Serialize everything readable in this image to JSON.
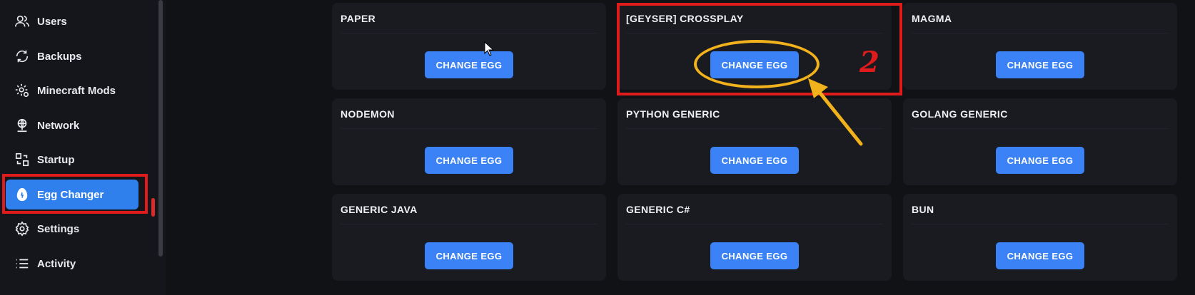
{
  "sidebar": {
    "items": [
      {
        "label": "Users",
        "icon": "users-icon"
      },
      {
        "label": "Backups",
        "icon": "backup-icon"
      },
      {
        "label": "Minecraft Mods",
        "icon": "mods-gear-icon"
      },
      {
        "label": "Network",
        "icon": "network-globe-icon"
      },
      {
        "label": "Startup",
        "icon": "startup-icon"
      },
      {
        "label": "Egg Changer",
        "icon": "egg-icon",
        "active": true
      },
      {
        "label": "Settings",
        "icon": "gear-icon"
      },
      {
        "label": "Activity",
        "icon": "activity-list-icon"
      }
    ]
  },
  "eggs": {
    "button_label": "CHANGE EGG",
    "cards": [
      {
        "title": "PAPER"
      },
      {
        "title": "[GEYSER] CROSSPLAY"
      },
      {
        "title": "MAGMA"
      },
      {
        "title": "NODEMON"
      },
      {
        "title": "PYTHON GENERIC"
      },
      {
        "title": "GOLANG GENERIC"
      },
      {
        "title": "GENERIC JAVA"
      },
      {
        "title": "GENERIC C#"
      },
      {
        "title": "BUN"
      }
    ]
  },
  "annotation": {
    "step": "2"
  },
  "colors": {
    "accent": "#3b82f6",
    "active_nav": "#2f80ed",
    "annotation_red": "#e01b1b",
    "annotation_yellow": "#f2b21b"
  }
}
